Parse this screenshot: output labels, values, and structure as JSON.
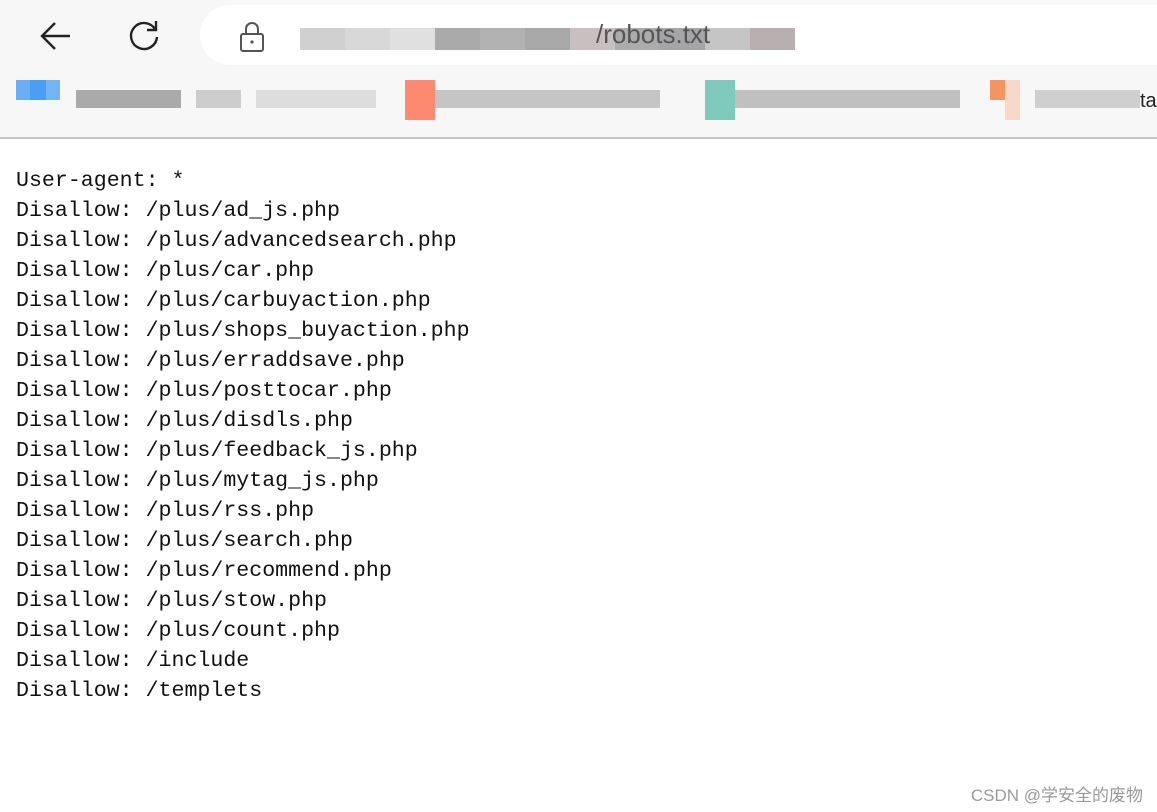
{
  "browser": {
    "back_icon": "arrow-left-icon",
    "reload_icon": "reload-icon",
    "lock_icon": "lock-icon",
    "url_visible": "/robots.txt",
    "bookmark_trailing_text": "ta"
  },
  "content": {
    "lines": [
      "User-agent: *",
      "Disallow: /plus/ad_js.php",
      "Disallow: /plus/advancedsearch.php",
      "Disallow: /plus/car.php",
      "Disallow: /plus/carbuyaction.php",
      "Disallow: /plus/shops_buyaction.php",
      "Disallow: /plus/erraddsave.php",
      "Disallow: /plus/posttocar.php",
      "Disallow: /plus/disdls.php",
      "Disallow: /plus/feedback_js.php",
      "Disallow: /plus/mytag_js.php",
      "Disallow: /plus/rss.php",
      "Disallow: /plus/search.php",
      "Disallow: /plus/recommend.php",
      "Disallow: /plus/stow.php",
      "Disallow: /plus/count.php",
      "Disallow: /include",
      "Disallow: /templets"
    ]
  },
  "watermark": "CSDN @学安全的废物"
}
